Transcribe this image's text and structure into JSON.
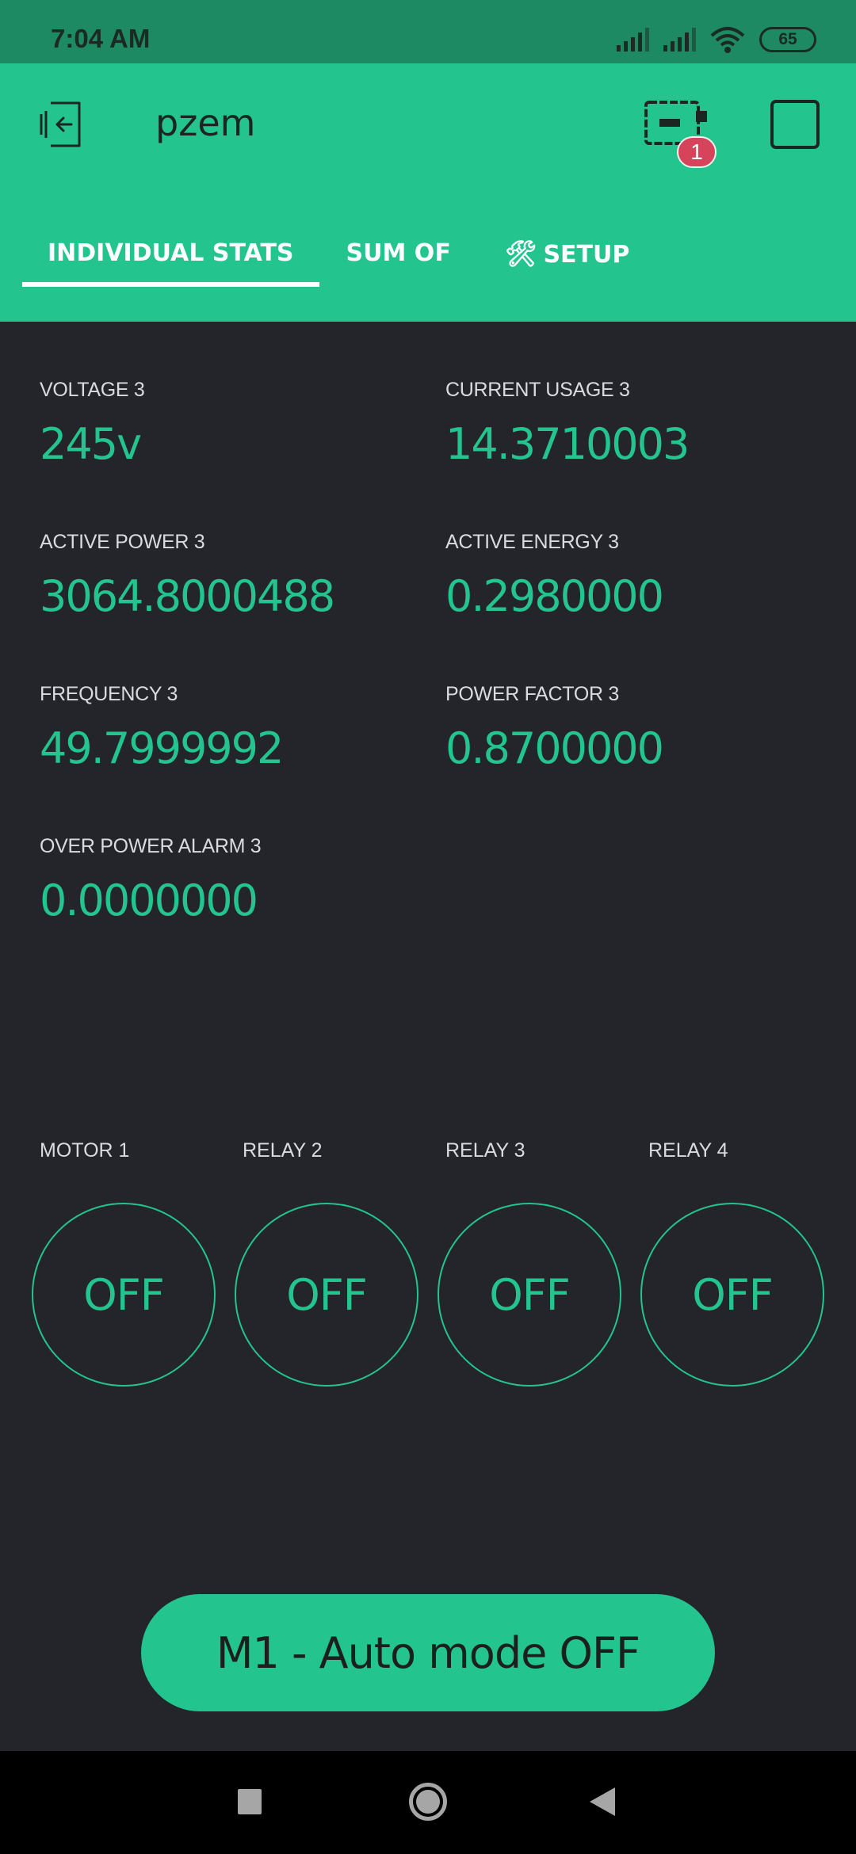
{
  "status_bar": {
    "time": "7:04 AM",
    "battery": "65"
  },
  "app_bar": {
    "title": "pzem",
    "device_badge": "1",
    "tabs": [
      {
        "label": "INDIVIDUAL STATS",
        "active": true
      },
      {
        "label": "SUM OF",
        "active": false
      },
      {
        "label": "SETUP",
        "icon": "tools-icon",
        "active": false
      }
    ]
  },
  "stats": [
    {
      "label": "VOLTAGE 3",
      "value": "245v"
    },
    {
      "label": "CURRENT USAGE 3",
      "value": "14.3710003"
    },
    {
      "label": "ACTIVE POWER 3",
      "value": "3064.8000488"
    },
    {
      "label": "ACTIVE ENERGY 3",
      "value": "0.2980000"
    },
    {
      "label": "FREQUENCY 3",
      "value": "49.7999992"
    },
    {
      "label": "POWER FACTOR 3",
      "value": "0.8700000"
    },
    {
      "label": "OVER POWER ALARM 3",
      "value": "0.0000000"
    }
  ],
  "switches": [
    {
      "label": "MOTOR 1",
      "state": "OFF"
    },
    {
      "label": "RELAY 2",
      "state": "OFF"
    },
    {
      "label": "RELAY 3",
      "state": "OFF"
    },
    {
      "label": "RELAY 4",
      "state": "OFF"
    }
  ],
  "auto_button": {
    "label": "M1 - Auto mode OFF"
  },
  "colors": {
    "accent": "#23c48e",
    "background": "#23252a",
    "status_bar": "#1d8a64",
    "badge": "#d6445c"
  }
}
